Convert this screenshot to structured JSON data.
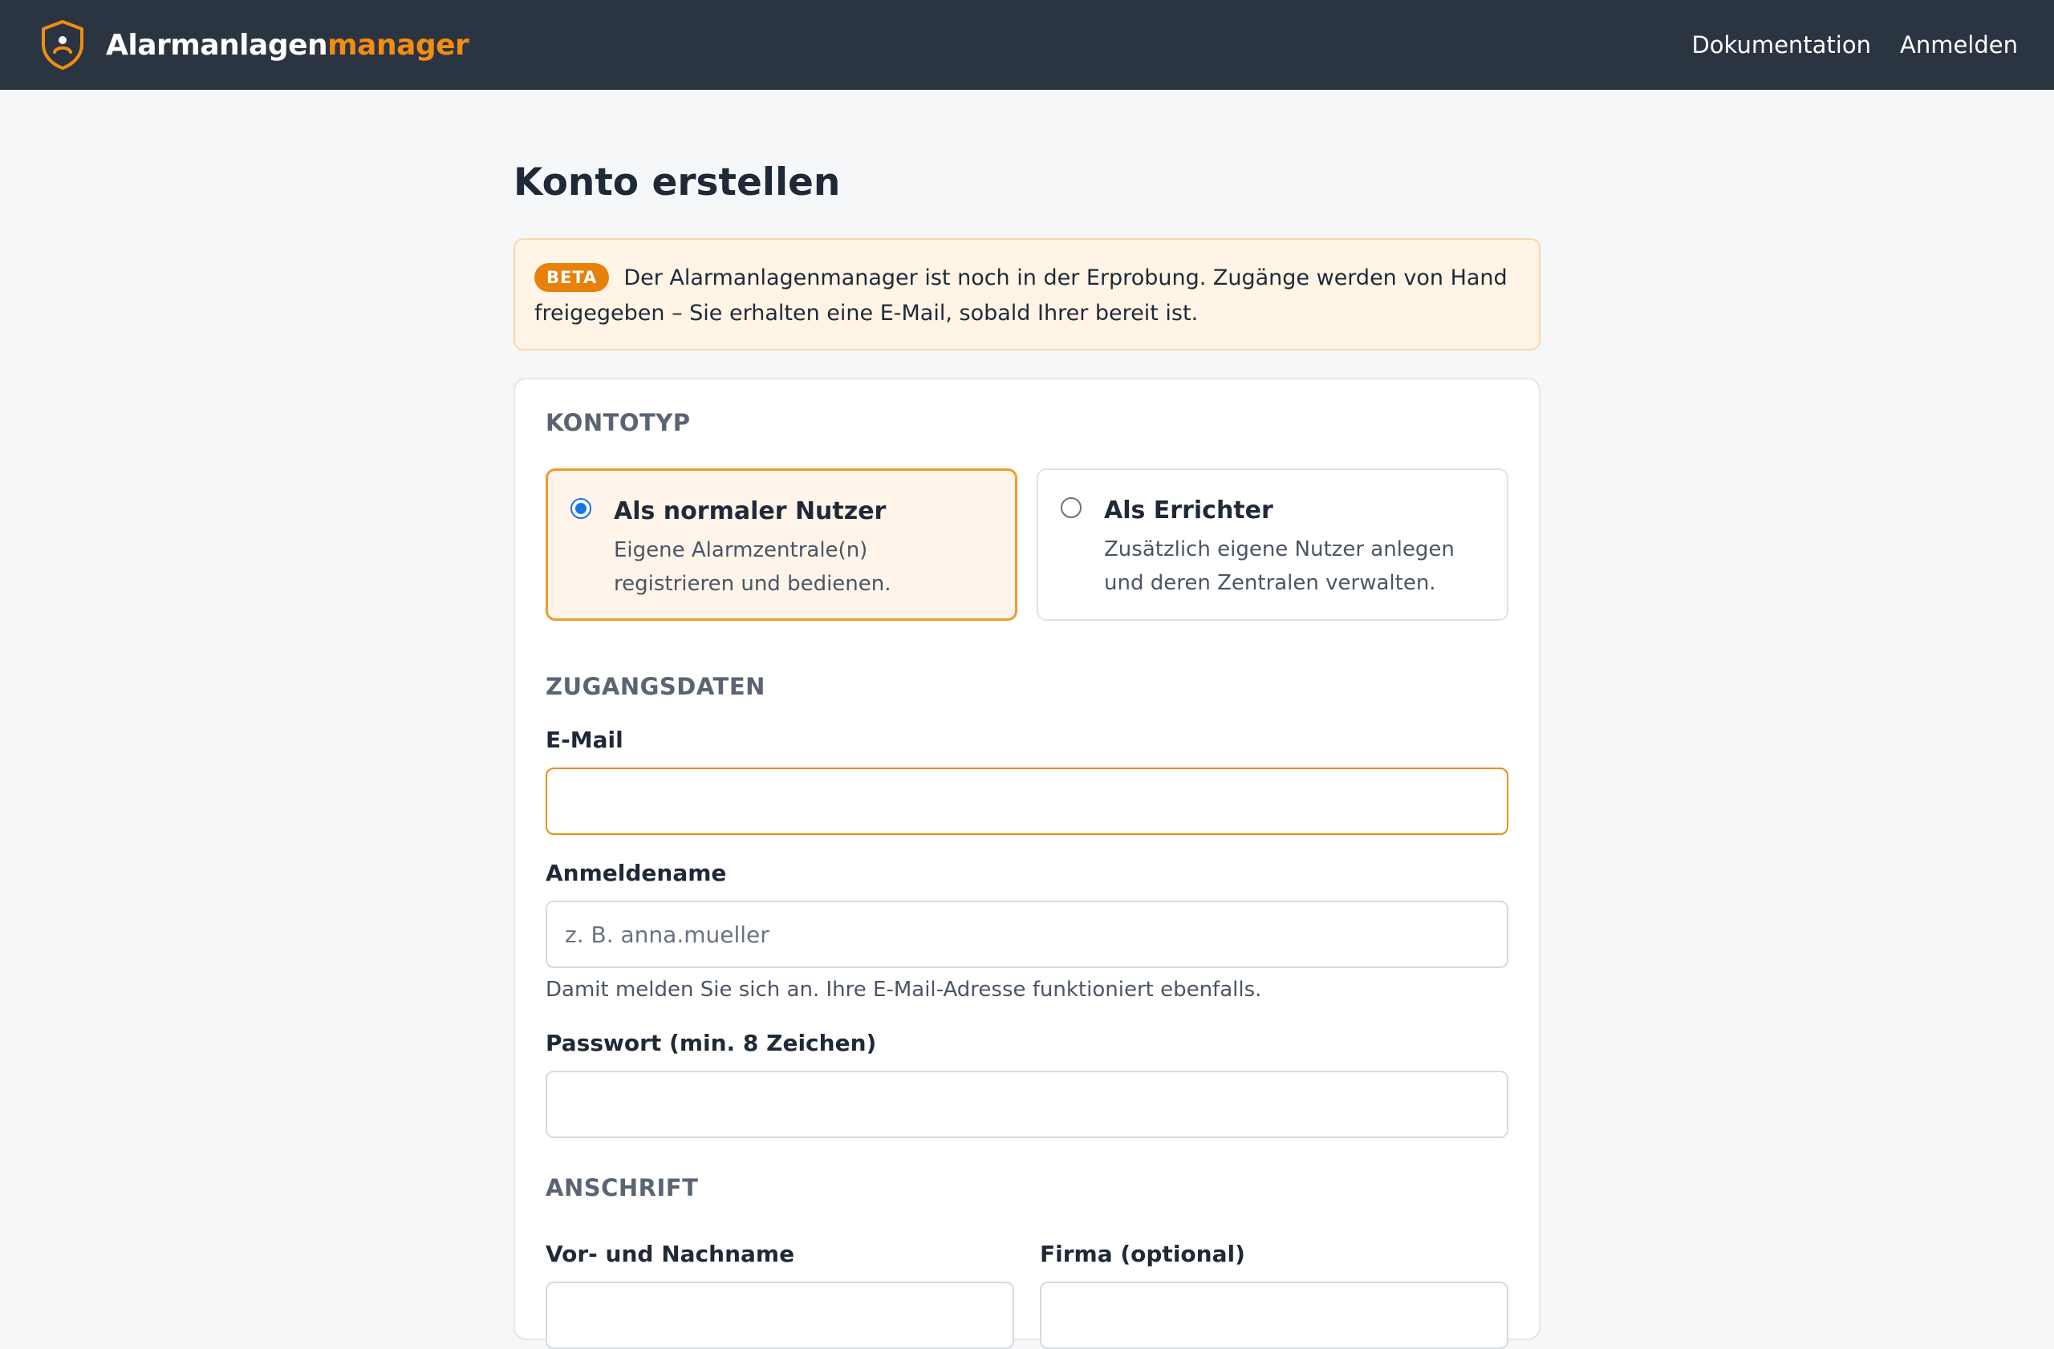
{
  "header": {
    "brand_main": "Alarmanlagen",
    "brand_accent": "manager",
    "nav": [
      "Dokumentation",
      "Anmelden"
    ],
    "colors": {
      "bar": "#2b3441",
      "accent": "#f28c13"
    }
  },
  "page": {
    "title": "Konto erstellen"
  },
  "beta": {
    "badge": "BETA",
    "text": "Der Alarmanlagenmanager ist noch in der Erprobung. Zugänge werden von Hand freigegeben – Sie erhalten eine E-Mail, sobald Ihrer bereit ist."
  },
  "account_type": {
    "label": "KONTOTYP",
    "options": [
      {
        "title": "Als normaler Nutzer",
        "desc": "Eigene Alarmzentrale(n) registrieren und bedienen.",
        "selected": true
      },
      {
        "title": "Als Errichter",
        "desc": "Zusätzlich eigene Nutzer anlegen und deren Zentralen verwalten.",
        "selected": false
      }
    ]
  },
  "credentials": {
    "label": "ZUGANGSDATEN",
    "email_label": "E-Mail",
    "email_value": "",
    "username_label": "Anmeldename",
    "username_placeholder": "z. B. anna.mueller",
    "username_hint": "Damit melden Sie sich an. Ihre E-Mail-Adresse funktioniert ebenfalls.",
    "password_label": "Passwort (min. 8 Zeichen)"
  },
  "address": {
    "label": "ANSCHRIFT",
    "name_label": "Vor- und Nachname",
    "company_label": "Firma (optional)"
  }
}
